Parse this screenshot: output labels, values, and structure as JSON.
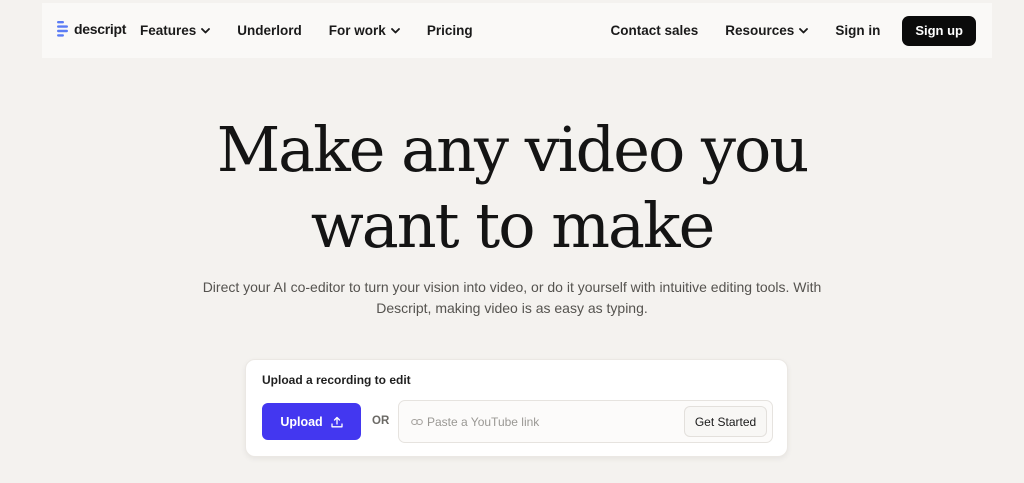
{
  "nav": {
    "logo_text": "descript",
    "left_items": [
      {
        "label": "Features",
        "has_dropdown": true
      },
      {
        "label": "Underlord",
        "has_dropdown": false
      },
      {
        "label": "For work",
        "has_dropdown": true
      },
      {
        "label": "Pricing",
        "has_dropdown": false
      }
    ],
    "right_items": [
      {
        "label": "Contact sales",
        "has_dropdown": false
      },
      {
        "label": "Resources",
        "has_dropdown": true
      },
      {
        "label": "Sign in",
        "has_dropdown": false
      }
    ],
    "signup_label": "Sign up"
  },
  "hero": {
    "title_line1": "Make any video you",
    "title_line2": "want to make",
    "subtitle_line1": "Direct your AI co-editor to turn your vision into video, or do it yourself with intuitive editing tools. With",
    "subtitle_line2": "Descript, making video is as easy as typing."
  },
  "upload_card": {
    "label": "Upload a recording to edit",
    "upload_button": "Upload",
    "or_text": "OR",
    "youtube_placeholder": "Paste a YouTube link",
    "youtube_value": "",
    "get_started_button": "Get Started"
  },
  "icons": {
    "logo": "descript-logo-icon",
    "dropdown": "chevron-down-icon",
    "upload": "upload-icon",
    "link": "link-icon"
  },
  "colors": {
    "background": "#f4f2ef",
    "nav_background": "#faf9f7",
    "signup_background": "#0b0b0b",
    "upload_accent": "#4337f0",
    "logo_accent": "#5b7cf5"
  }
}
